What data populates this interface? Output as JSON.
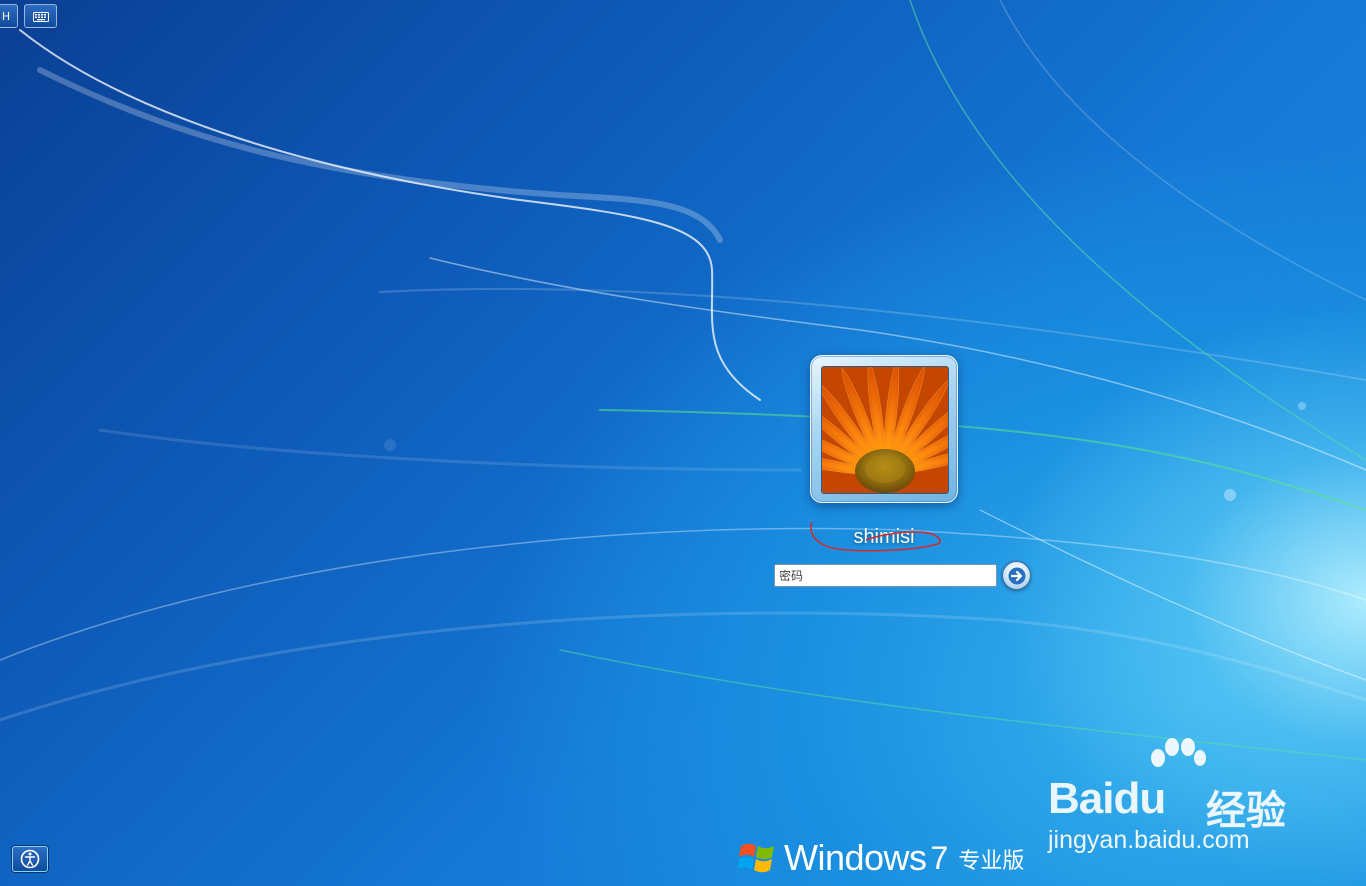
{
  "toolbar": {
    "language_label": "H",
    "keyboard_icon": "keyboard-icon"
  },
  "user": {
    "name": "shimisi",
    "avatar_icon": "orange-flower-avatar"
  },
  "login": {
    "password_placeholder": "密码",
    "submit_icon": "arrow-right-icon"
  },
  "accessibility": {
    "icon": "ease-of-access-icon"
  },
  "branding": {
    "product_word": "Windows",
    "version": "7",
    "edition": "专业版"
  },
  "watermark": {
    "brand": "Bai",
    "brand_tail": "du",
    "brand_cn": "经验",
    "url": "jingyan.baidu.com"
  },
  "colors": {
    "annotation": "#d42a2a",
    "background_dark": "#0a3f94",
    "background_light": "#39b3ee"
  }
}
